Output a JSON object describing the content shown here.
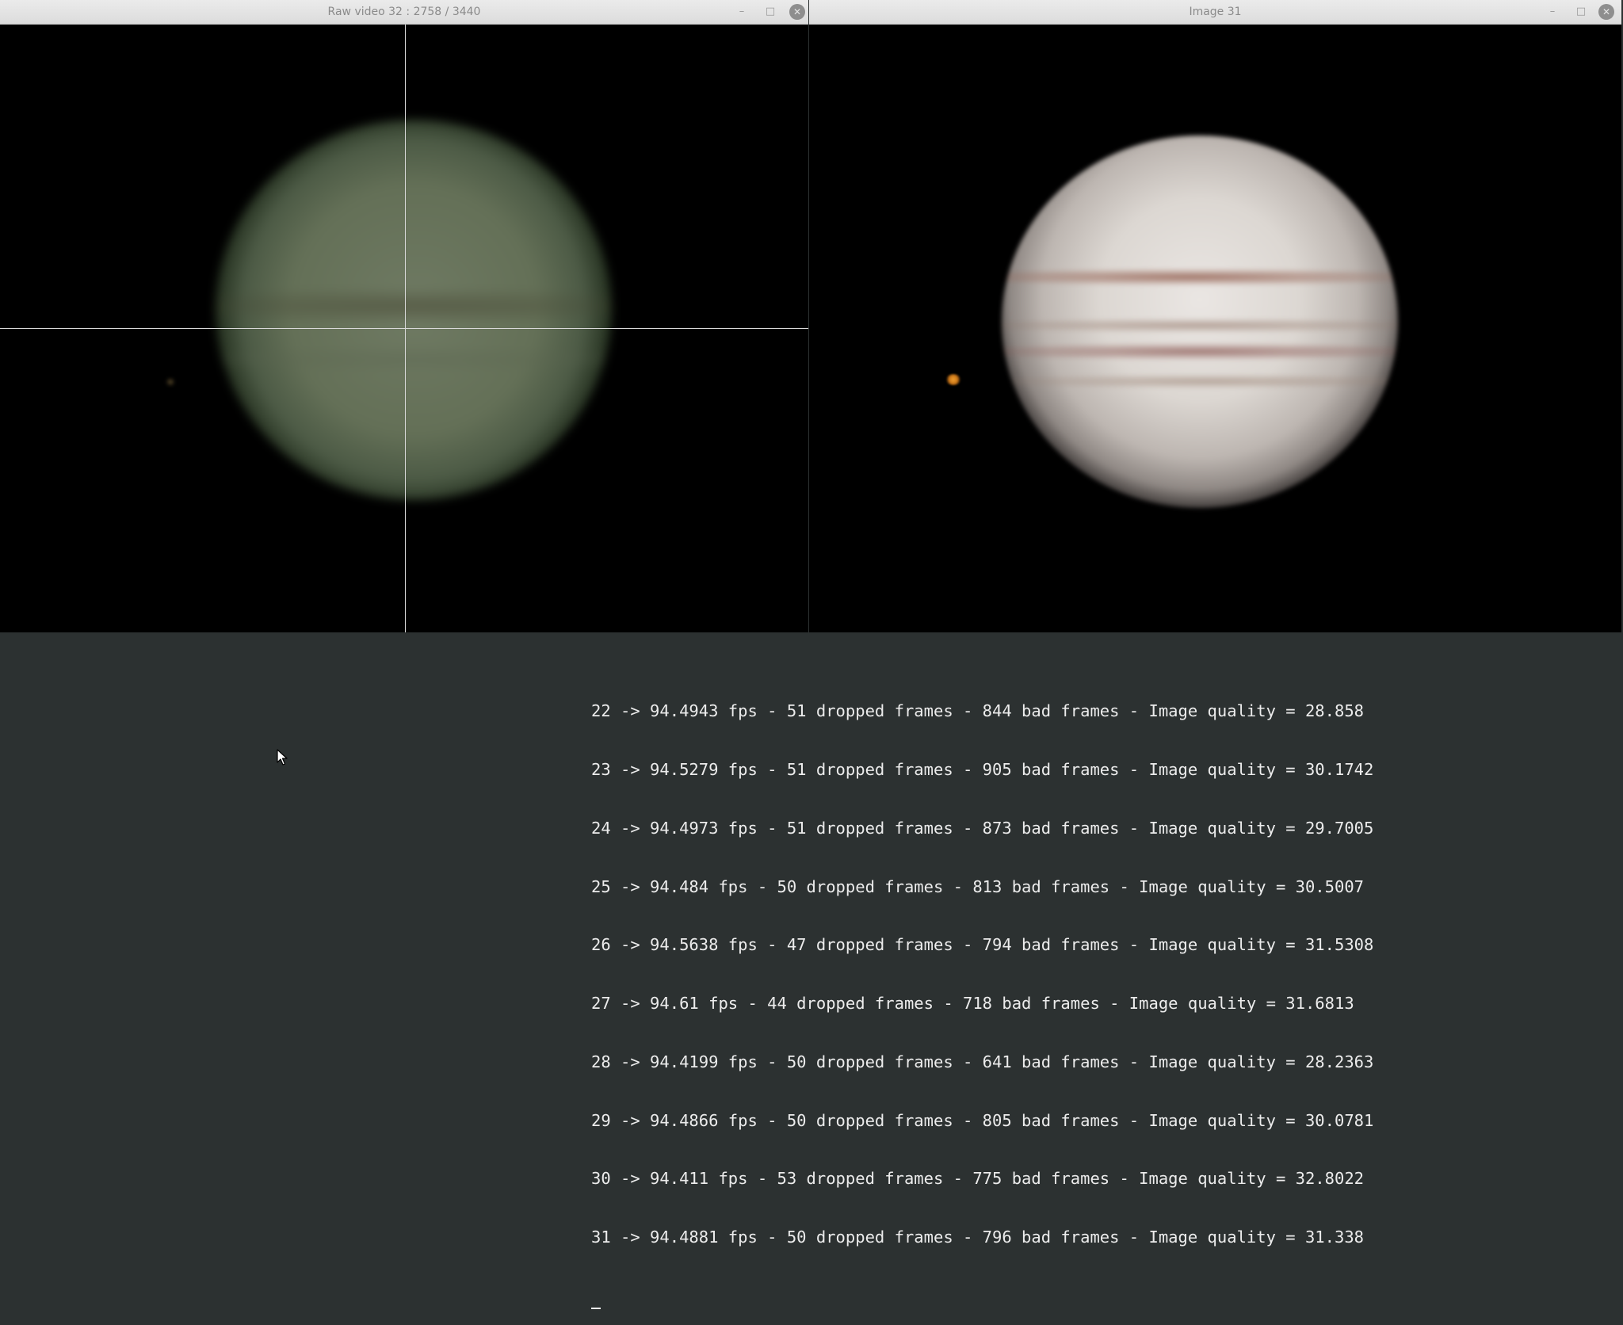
{
  "windows": {
    "left": {
      "title": "Raw video 32 : 2758 / 3440",
      "minimize_glyph": "–",
      "maximize_glyph": "□",
      "close_glyph": "✕"
    },
    "right": {
      "title": "Image 31",
      "minimize_glyph": "–",
      "maximize_glyph": "□",
      "close_glyph": "✕"
    }
  },
  "console": {
    "lines": [
      "22 -> 94.4943 fps - 51 dropped frames - 844 bad frames - Image quality = 28.858",
      "23 -> 94.5279 fps - 51 dropped frames - 905 bad frames - Image quality = 30.1742",
      "24 -> 94.4973 fps - 51 dropped frames - 873 bad frames - Image quality = 29.7005",
      "25 -> 94.484 fps - 50 dropped frames - 813 bad frames - Image quality = 30.5007",
      "26 -> 94.5638 fps - 47 dropped frames - 794 bad frames - Image quality = 31.5308",
      "27 -> 94.61 fps - 44 dropped frames - 718 bad frames - Image quality = 31.6813",
      "28 -> 94.4199 fps - 50 dropped frames - 641 bad frames - Image quality = 28.2363",
      "29 -> 94.4866 fps - 50 dropped frames - 805 bad frames - Image quality = 30.0781",
      "30 -> 94.411 fps - 53 dropped frames - 775 bad frames - Image quality = 32.8022",
      "31 -> 94.4881 fps - 50 dropped frames - 796 bad frames - Image quality = 31.338"
    ]
  },
  "icons": {
    "mouse": "mouse-pointer-icon"
  }
}
